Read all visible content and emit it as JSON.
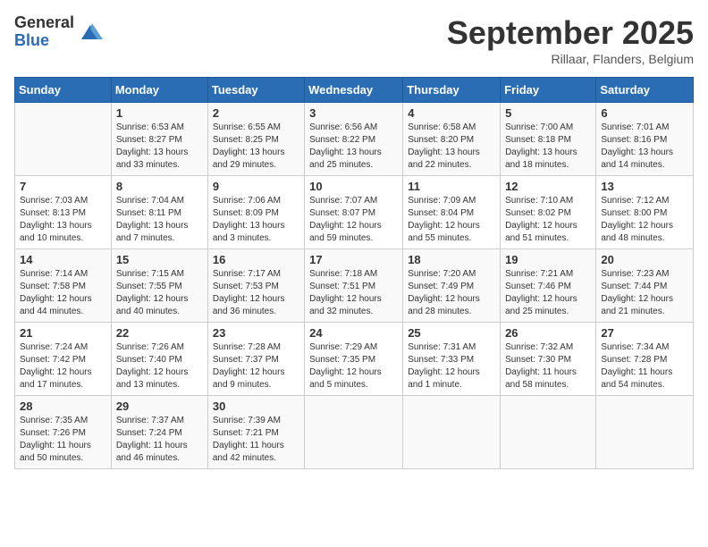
{
  "header": {
    "logo_general": "General",
    "logo_blue": "Blue",
    "month_title": "September 2025",
    "location": "Rillaar, Flanders, Belgium"
  },
  "days_of_week": [
    "Sunday",
    "Monday",
    "Tuesday",
    "Wednesday",
    "Thursday",
    "Friday",
    "Saturday"
  ],
  "weeks": [
    [
      {
        "day": "",
        "info": ""
      },
      {
        "day": "1",
        "info": "Sunrise: 6:53 AM\nSunset: 8:27 PM\nDaylight: 13 hours and 33 minutes."
      },
      {
        "day": "2",
        "info": "Sunrise: 6:55 AM\nSunset: 8:25 PM\nDaylight: 13 hours and 29 minutes."
      },
      {
        "day": "3",
        "info": "Sunrise: 6:56 AM\nSunset: 8:22 PM\nDaylight: 13 hours and 25 minutes."
      },
      {
        "day": "4",
        "info": "Sunrise: 6:58 AM\nSunset: 8:20 PM\nDaylight: 13 hours and 22 minutes."
      },
      {
        "day": "5",
        "info": "Sunrise: 7:00 AM\nSunset: 8:18 PM\nDaylight: 13 hours and 18 minutes."
      },
      {
        "day": "6",
        "info": "Sunrise: 7:01 AM\nSunset: 8:16 PM\nDaylight: 13 hours and 14 minutes."
      }
    ],
    [
      {
        "day": "7",
        "info": "Sunrise: 7:03 AM\nSunset: 8:13 PM\nDaylight: 13 hours and 10 minutes."
      },
      {
        "day": "8",
        "info": "Sunrise: 7:04 AM\nSunset: 8:11 PM\nDaylight: 13 hours and 7 minutes."
      },
      {
        "day": "9",
        "info": "Sunrise: 7:06 AM\nSunset: 8:09 PM\nDaylight: 13 hours and 3 minutes."
      },
      {
        "day": "10",
        "info": "Sunrise: 7:07 AM\nSunset: 8:07 PM\nDaylight: 12 hours and 59 minutes."
      },
      {
        "day": "11",
        "info": "Sunrise: 7:09 AM\nSunset: 8:04 PM\nDaylight: 12 hours and 55 minutes."
      },
      {
        "day": "12",
        "info": "Sunrise: 7:10 AM\nSunset: 8:02 PM\nDaylight: 12 hours and 51 minutes."
      },
      {
        "day": "13",
        "info": "Sunrise: 7:12 AM\nSunset: 8:00 PM\nDaylight: 12 hours and 48 minutes."
      }
    ],
    [
      {
        "day": "14",
        "info": "Sunrise: 7:14 AM\nSunset: 7:58 PM\nDaylight: 12 hours and 44 minutes."
      },
      {
        "day": "15",
        "info": "Sunrise: 7:15 AM\nSunset: 7:55 PM\nDaylight: 12 hours and 40 minutes."
      },
      {
        "day": "16",
        "info": "Sunrise: 7:17 AM\nSunset: 7:53 PM\nDaylight: 12 hours and 36 minutes."
      },
      {
        "day": "17",
        "info": "Sunrise: 7:18 AM\nSunset: 7:51 PM\nDaylight: 12 hours and 32 minutes."
      },
      {
        "day": "18",
        "info": "Sunrise: 7:20 AM\nSunset: 7:49 PM\nDaylight: 12 hours and 28 minutes."
      },
      {
        "day": "19",
        "info": "Sunrise: 7:21 AM\nSunset: 7:46 PM\nDaylight: 12 hours and 25 minutes."
      },
      {
        "day": "20",
        "info": "Sunrise: 7:23 AM\nSunset: 7:44 PM\nDaylight: 12 hours and 21 minutes."
      }
    ],
    [
      {
        "day": "21",
        "info": "Sunrise: 7:24 AM\nSunset: 7:42 PM\nDaylight: 12 hours and 17 minutes."
      },
      {
        "day": "22",
        "info": "Sunrise: 7:26 AM\nSunset: 7:40 PM\nDaylight: 12 hours and 13 minutes."
      },
      {
        "day": "23",
        "info": "Sunrise: 7:28 AM\nSunset: 7:37 PM\nDaylight: 12 hours and 9 minutes."
      },
      {
        "day": "24",
        "info": "Sunrise: 7:29 AM\nSunset: 7:35 PM\nDaylight: 12 hours and 5 minutes."
      },
      {
        "day": "25",
        "info": "Sunrise: 7:31 AM\nSunset: 7:33 PM\nDaylight: 12 hours and 1 minute."
      },
      {
        "day": "26",
        "info": "Sunrise: 7:32 AM\nSunset: 7:30 PM\nDaylight: 11 hours and 58 minutes."
      },
      {
        "day": "27",
        "info": "Sunrise: 7:34 AM\nSunset: 7:28 PM\nDaylight: 11 hours and 54 minutes."
      }
    ],
    [
      {
        "day": "28",
        "info": "Sunrise: 7:35 AM\nSunset: 7:26 PM\nDaylight: 11 hours and 50 minutes."
      },
      {
        "day": "29",
        "info": "Sunrise: 7:37 AM\nSunset: 7:24 PM\nDaylight: 11 hours and 46 minutes."
      },
      {
        "day": "30",
        "info": "Sunrise: 7:39 AM\nSunset: 7:21 PM\nDaylight: 11 hours and 42 minutes."
      },
      {
        "day": "",
        "info": ""
      },
      {
        "day": "",
        "info": ""
      },
      {
        "day": "",
        "info": ""
      },
      {
        "day": "",
        "info": ""
      }
    ]
  ]
}
